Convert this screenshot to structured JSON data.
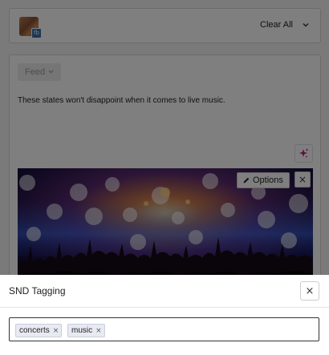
{
  "account_card": {
    "network_badge": "fb",
    "clear_all_label": "Clear All"
  },
  "composer": {
    "feed_label": "Feed",
    "post_text": "These states won't disappoint when it comes to live music.",
    "media": {
      "options_label": "Options",
      "close_glyph": "×"
    }
  },
  "modal": {
    "title": "SND Tagging",
    "close_glyph": "×",
    "tags": [
      {
        "label": "concerts",
        "remove_glyph": "×"
      },
      {
        "label": "music",
        "remove_glyph": "×"
      }
    ]
  },
  "icons": {
    "avatar": "profile-avatar-icon",
    "network_badge": "facebook-badge-icon",
    "clear_all_chevron": "chevron-down-icon",
    "feed_chevron": "chevron-down-icon",
    "ai_button": "sparkles-icon",
    "options": "pencil-icon",
    "media_close": "close-icon",
    "modal_close": "close-icon",
    "chip_remove": "close-icon"
  },
  "colors": {
    "overlay": "#000000",
    "ai_sparkle": "#c0187c",
    "tag_chip_bg": "#e7eaf2",
    "input_border": "#333333"
  }
}
